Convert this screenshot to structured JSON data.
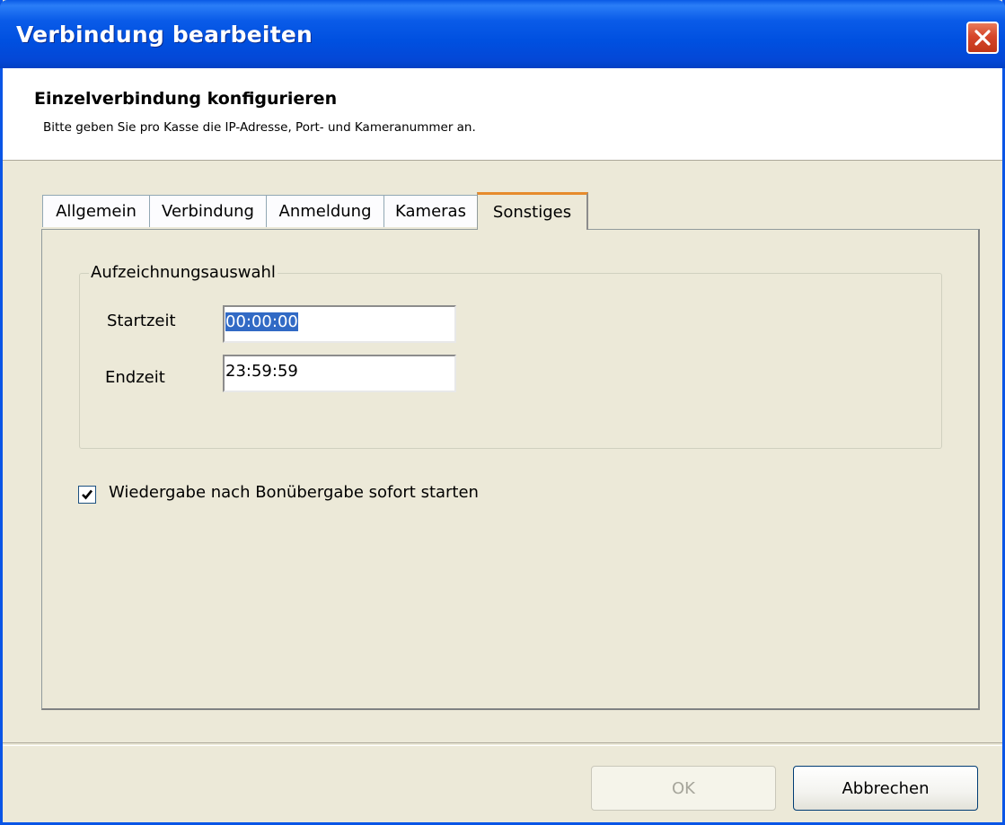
{
  "window": {
    "title": "Verbindung bearbeiten"
  },
  "header": {
    "title": "Einzelverbindung konfigurieren",
    "subtitle": "Bitte geben Sie pro Kasse die IP-Adresse, Port- und Kameranummer an."
  },
  "tabs": [
    {
      "label": "Allgemein",
      "active": false
    },
    {
      "label": "Verbindung",
      "active": false
    },
    {
      "label": "Anmeldung",
      "active": false
    },
    {
      "label": "Kameras",
      "active": false
    },
    {
      "label": "Sonstiges",
      "active": true
    }
  ],
  "recording": {
    "group_label": "Aufzeichnungsauswahl",
    "start_label": "Startzeit",
    "start_value": "00:00:00",
    "end_label": "Endzeit",
    "end_value": "23:59:59"
  },
  "playback": {
    "checkbox_label": "Wiedergabe nach Bonübergabe sofort starten",
    "checked": true
  },
  "buttons": {
    "ok": "OK",
    "ok_enabled": false,
    "cancel": "Abbrechen"
  },
  "colors": {
    "titlebar": "#0050e0",
    "close_button": "#d6462a",
    "selection": "#316ac5",
    "active_tab_accent": "#e68b2c",
    "dialog_background": "#ece9d8"
  }
}
